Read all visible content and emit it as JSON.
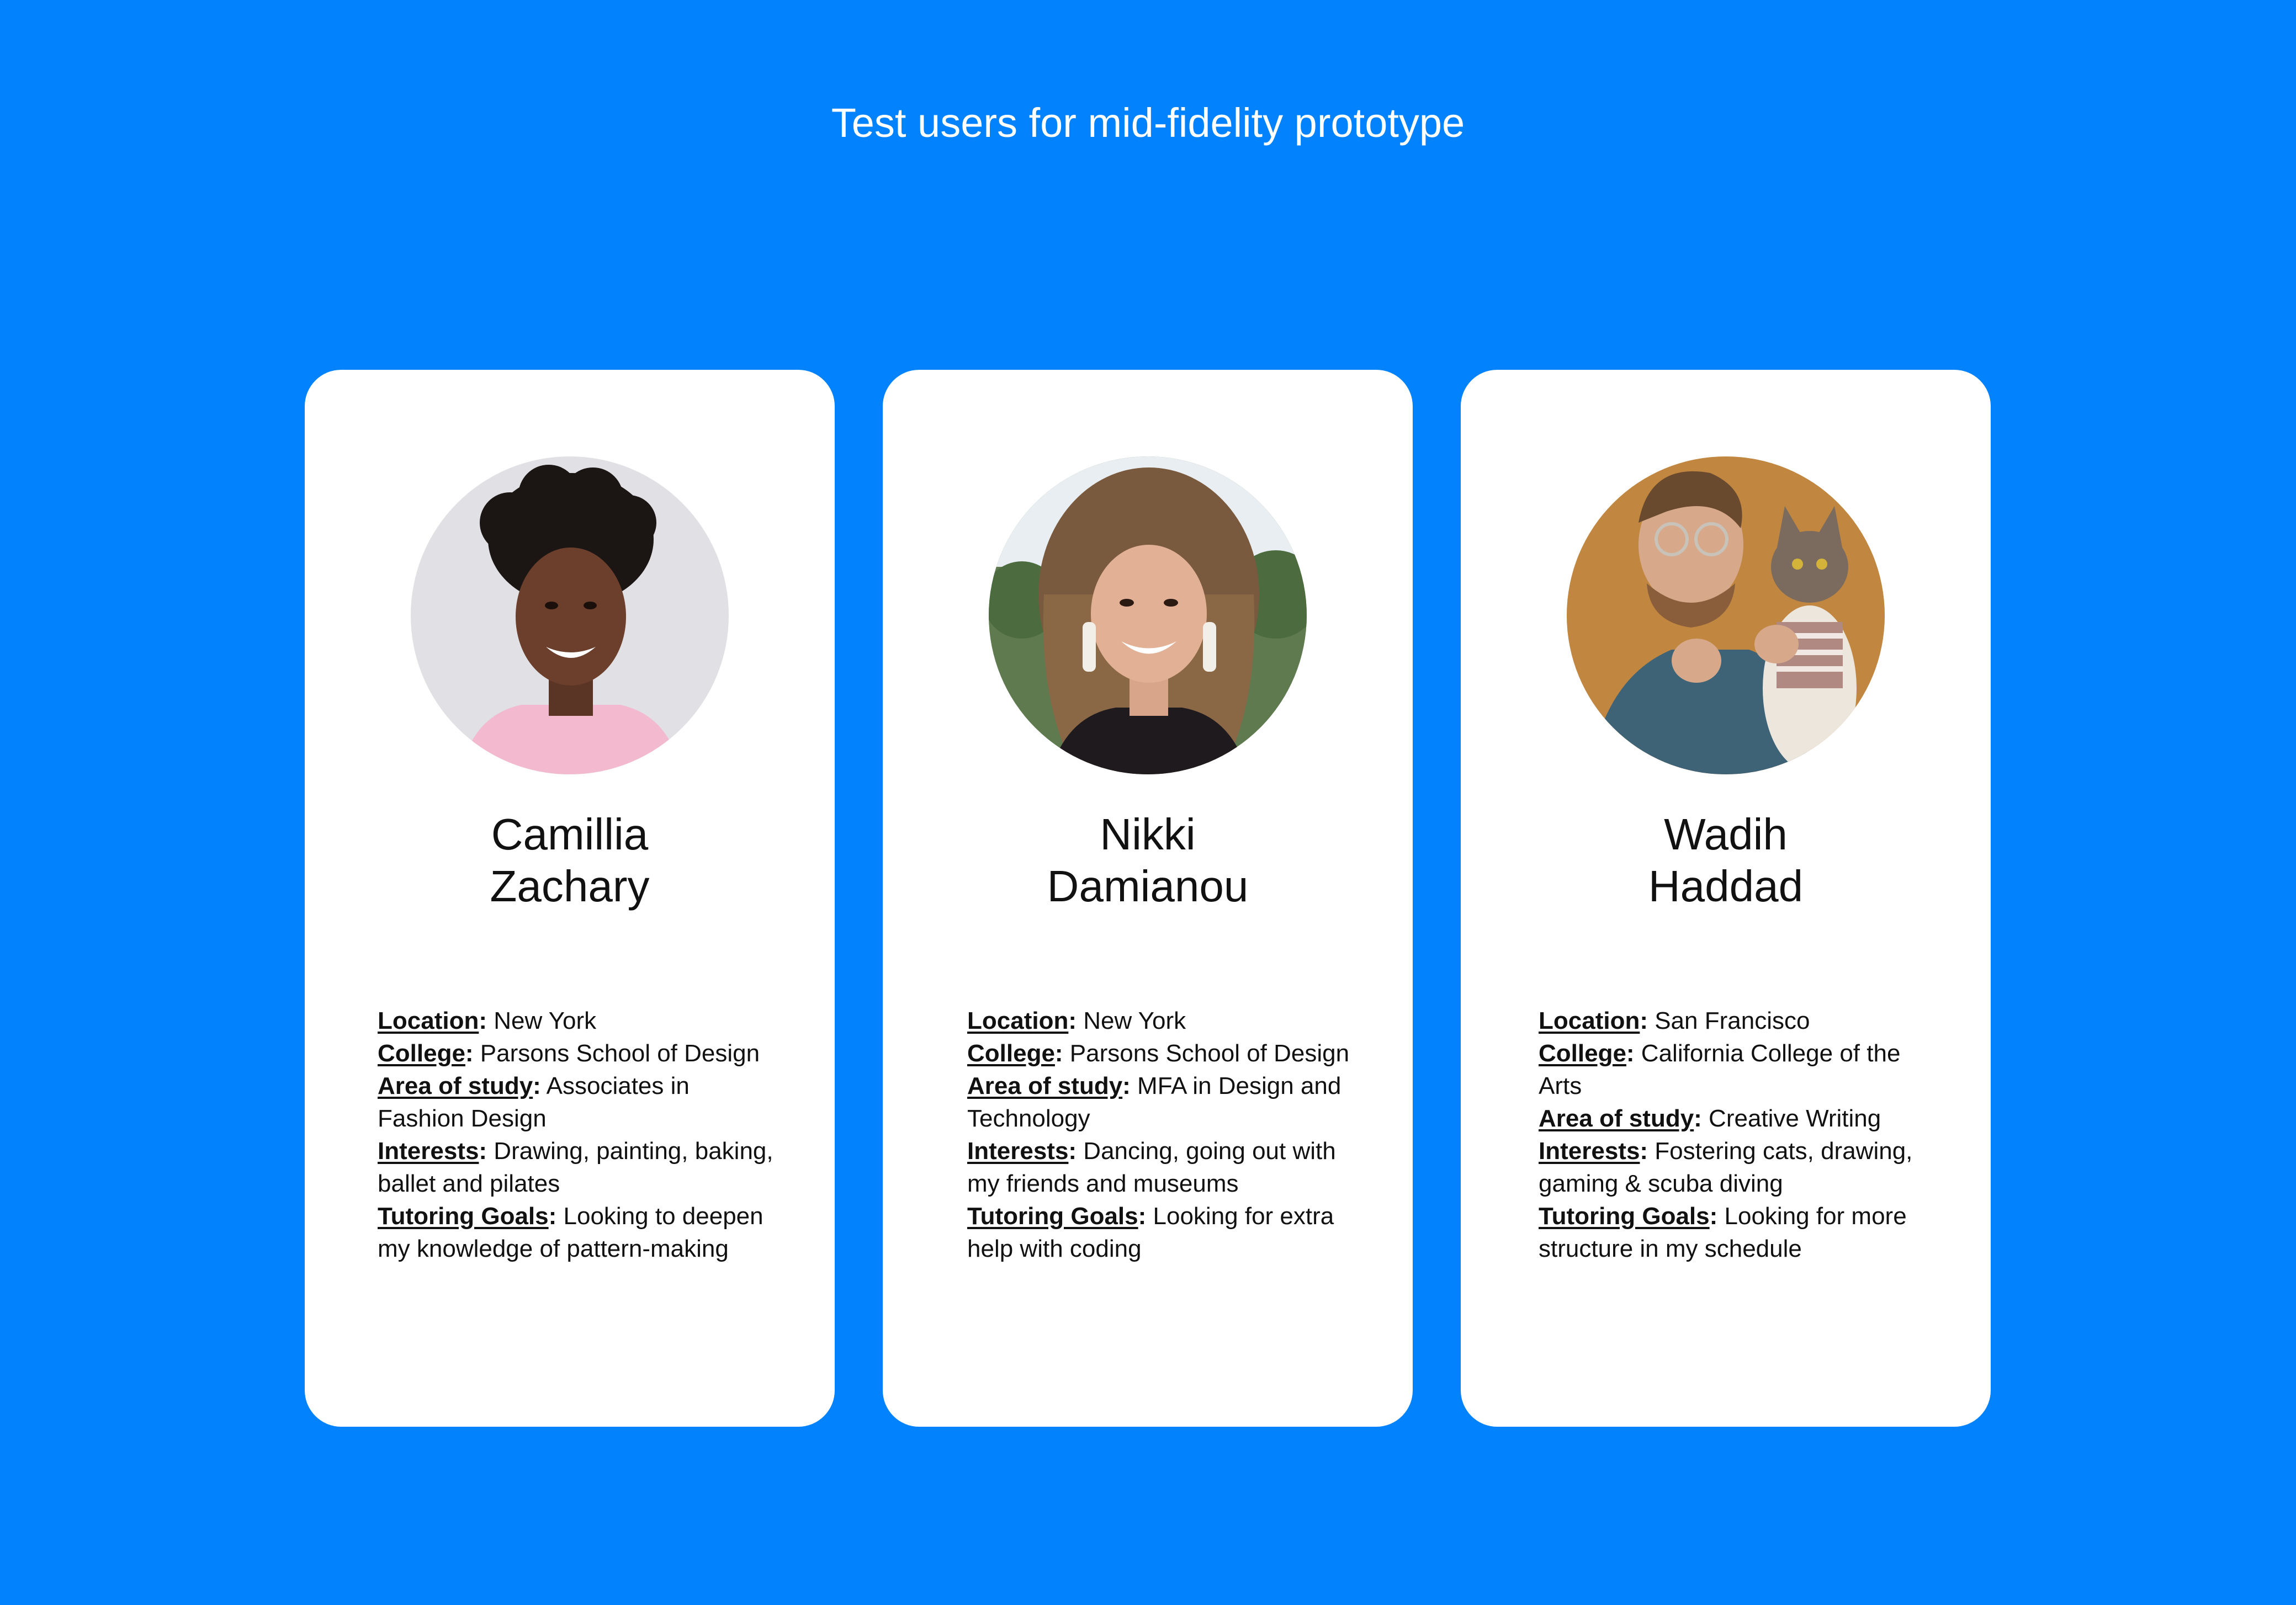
{
  "page": {
    "title": "Test users for mid-fidelity prototype",
    "background_color": "#0382FD"
  },
  "users": [
    {
      "first_name": "Camillia",
      "last_name": "Zachary",
      "details": [
        {
          "label": "Location",
          "value": " New York"
        },
        {
          "label": "College",
          "value": " Parsons School of Design"
        },
        {
          "label": "Area of study",
          "value": " Associates in Fashion Design"
        },
        {
          "label": "Interests",
          "value": " Drawing, painting, baking, ballet and pilates"
        },
        {
          "label": "Tutoring Goals",
          "value": " Looking to deepen my knowledge of pattern-making"
        }
      ]
    },
    {
      "first_name": "Nikki",
      "last_name": "Damianou",
      "details": [
        {
          "label": "Location",
          "value": " New York"
        },
        {
          "label": "College",
          "value": " Parsons School of Design"
        },
        {
          "label": "Area of study",
          "value": " MFA in Design and Technology"
        },
        {
          "label": "Interests",
          "value": " Dancing, going out with my friends and museums"
        },
        {
          "label": "Tutoring Goals",
          "value": " Looking for extra help with coding"
        }
      ]
    },
    {
      "first_name": "Wadih",
      "last_name": "Haddad",
      "details": [
        {
          "label": "Location",
          "value": " San Francisco"
        },
        {
          "label": "College",
          "value": " California College of the Arts"
        },
        {
          "label": "Area of study",
          "value": " Creative Writing"
        },
        {
          "label": "Interests",
          "value": " Fostering cats, drawing, gaming & scuba diving"
        },
        {
          "label": "Tutoring Goals",
          "value": " Looking for more structure in my schedule"
        }
      ]
    }
  ]
}
